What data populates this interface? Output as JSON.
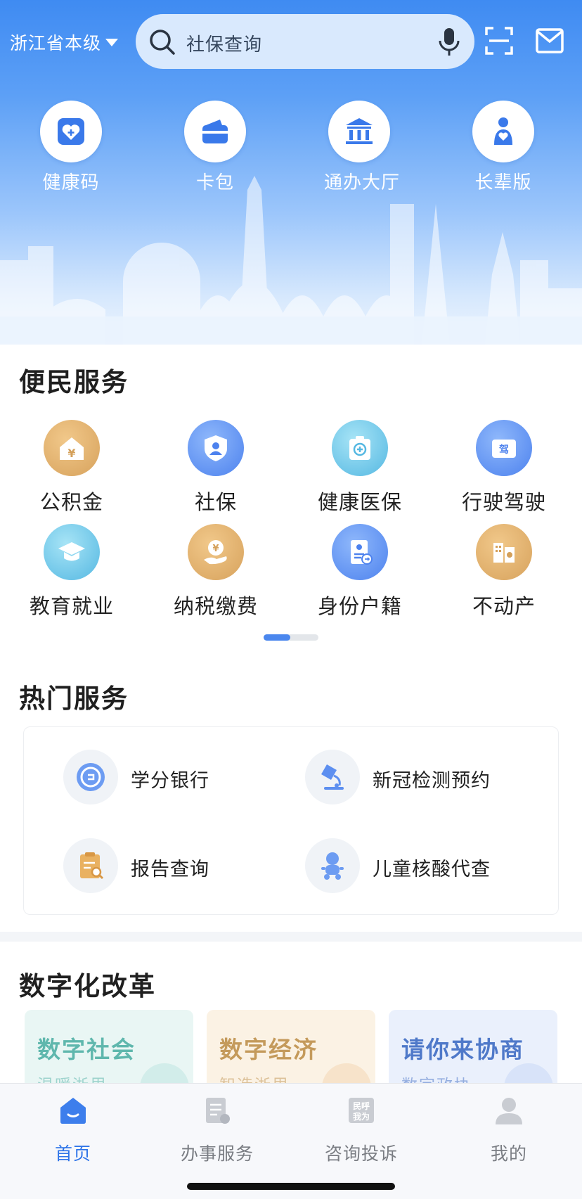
{
  "header": {
    "region": "浙江省本级",
    "search_placeholder": "社保查询"
  },
  "quick_actions": [
    {
      "label": "健康码",
      "icon": "health-code-heart-icon"
    },
    {
      "label": "卡包",
      "icon": "wallet-icon"
    },
    {
      "label": "通办大厅",
      "icon": "government-hall-icon"
    },
    {
      "label": "长辈版",
      "icon": "elder-mode-icon"
    }
  ],
  "convenience": {
    "title": "便民服务",
    "items": [
      {
        "label": "公积金",
        "icon": "housing-fund-icon"
      },
      {
        "label": "社保",
        "icon": "social-security-icon"
      },
      {
        "label": "健康医保",
        "icon": "medical-insurance-icon"
      },
      {
        "label": "行驶驾驶",
        "icon": "driving-license-icon"
      },
      {
        "label": "教育就业",
        "icon": "graduation-cap-icon"
      },
      {
        "label": "纳税缴费",
        "icon": "tax-payment-icon"
      },
      {
        "label": "身份户籍",
        "icon": "id-card-icon"
      },
      {
        "label": "不动产",
        "icon": "real-estate-icon"
      }
    ]
  },
  "hot": {
    "title": "热门服务",
    "items": [
      {
        "label": "学分银行",
        "icon": "credit-bank-icon"
      },
      {
        "label": "新冠检测预约",
        "icon": "microscope-icon"
      },
      {
        "label": "报告查询",
        "icon": "report-search-icon"
      },
      {
        "label": "儿童核酸代查",
        "icon": "child-icon"
      }
    ]
  },
  "digital": {
    "title": "数字化改革",
    "cards": [
      {
        "title": "数字社会",
        "subtitle": "温暖浙里",
        "color": "#5fb7ad"
      },
      {
        "title": "数字经济",
        "subtitle": "智造浙里",
        "color": "#c49a5b"
      },
      {
        "title": "请你来协商",
        "subtitle": "数字政协",
        "color": "#4f79c9"
      }
    ]
  },
  "tabs": [
    {
      "label": "首页",
      "icon": "home-icon",
      "active": true
    },
    {
      "label": "办事服务",
      "icon": "service-document-icon",
      "active": false
    },
    {
      "label": "咨询投诉",
      "icon": "consult-complaint-icon",
      "active": false
    },
    {
      "label": "我的",
      "icon": "user-profile-icon",
      "active": false
    }
  ],
  "colors": {
    "primary": "#2e74e8",
    "hero_top": "#3f8bf2"
  }
}
